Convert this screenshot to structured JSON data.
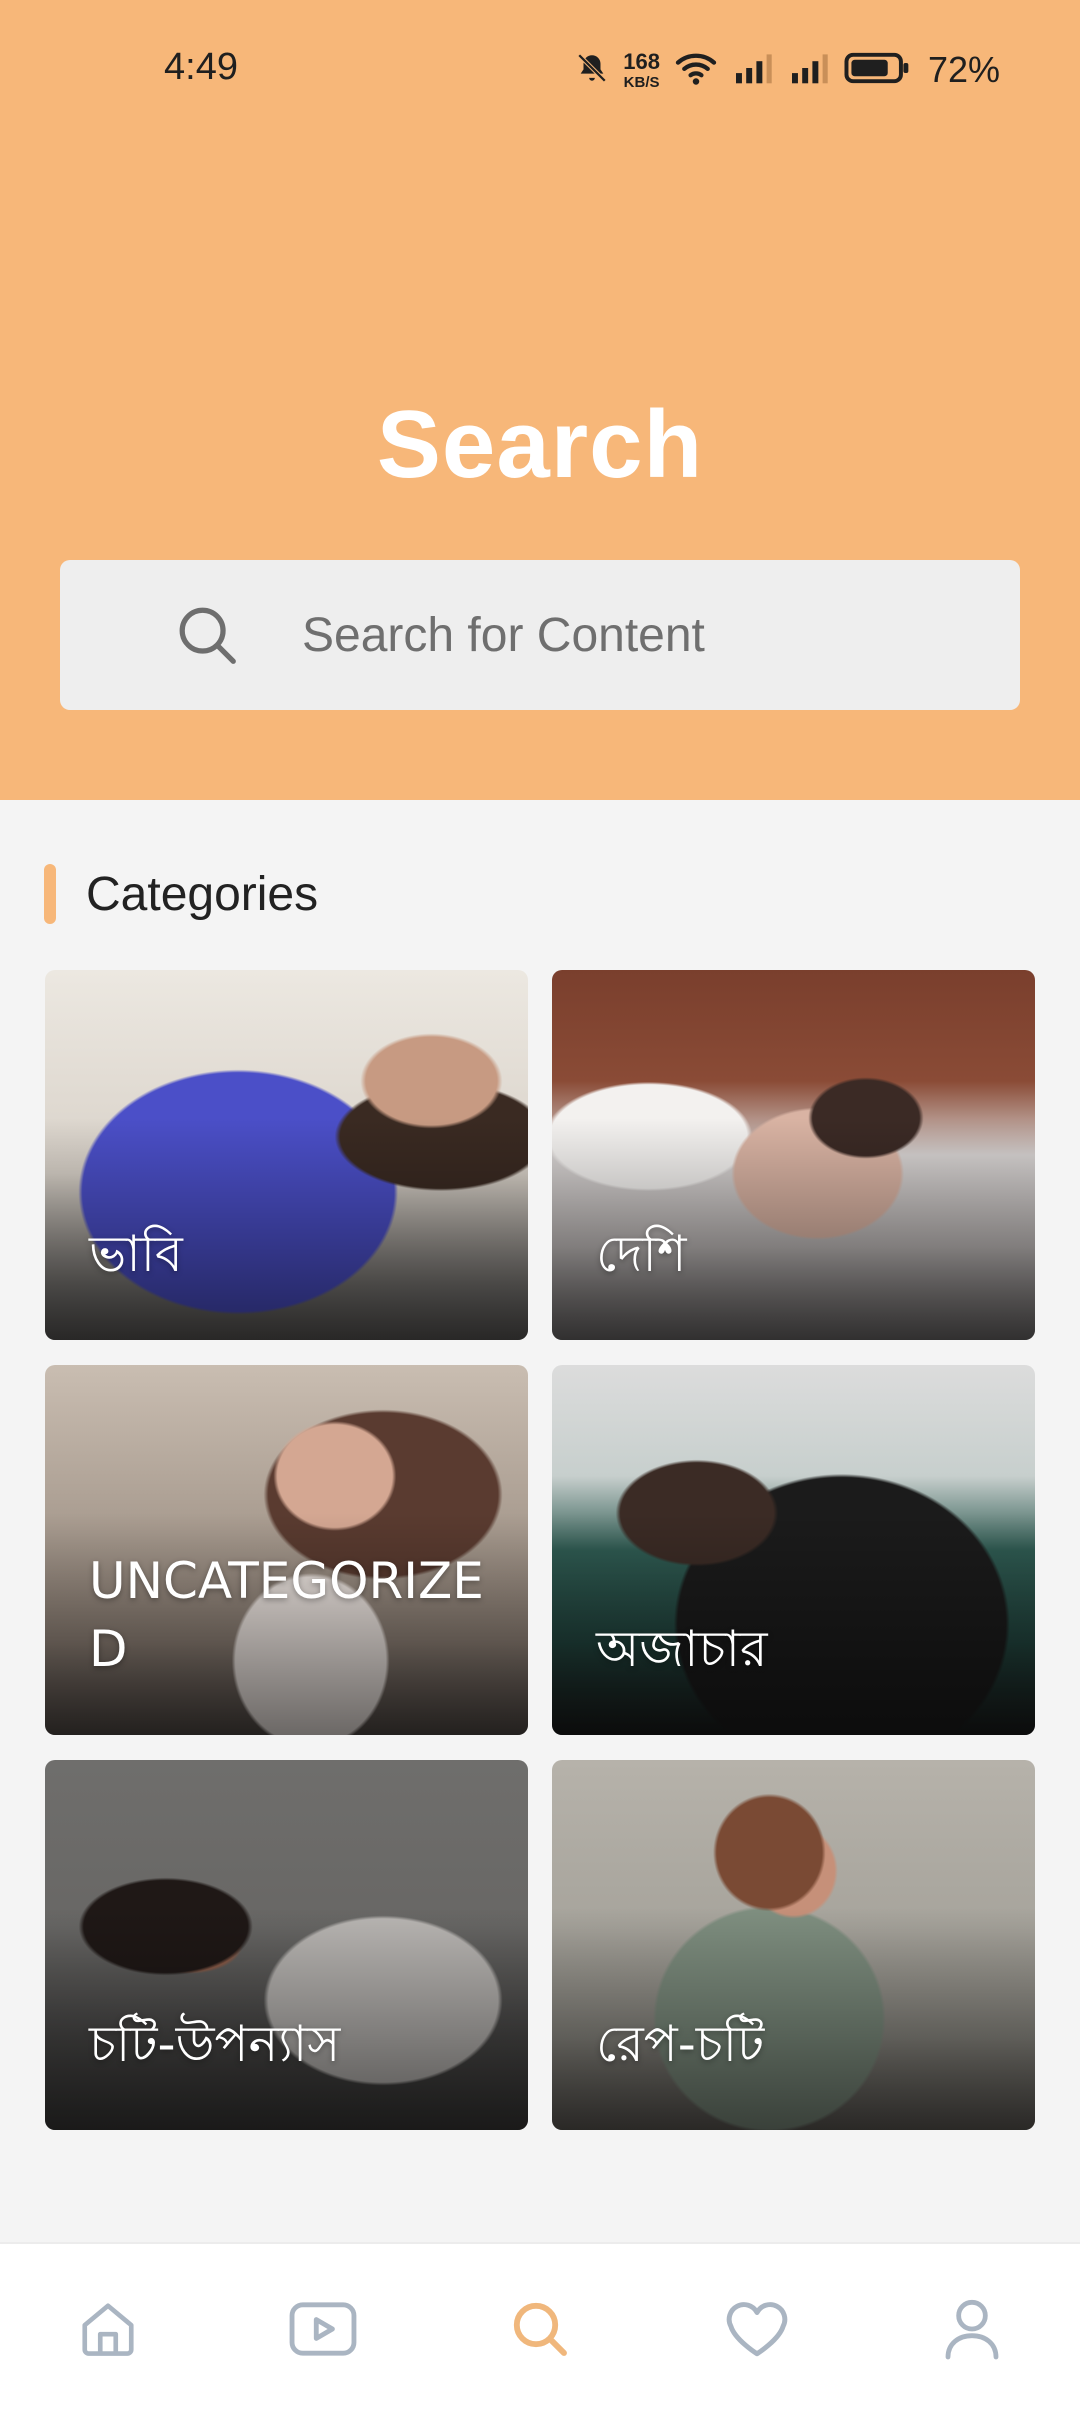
{
  "status_bar": {
    "time": "4:49",
    "net_speed_value": "168",
    "net_speed_unit": "KB/S",
    "battery_percent": "72%"
  },
  "header": {
    "title": "Search",
    "background_color": "#f7b779"
  },
  "search": {
    "placeholder": "Search for Content",
    "icon": "search-icon"
  },
  "categories": {
    "heading": "Categories",
    "accent_color": "#f7b779",
    "items": [
      {
        "label": "ভাবি"
      },
      {
        "label": "দেশি"
      },
      {
        "label": "UNCATEGORIZED"
      },
      {
        "label": "অজাচার"
      },
      {
        "label": "চটি-উপন্যাস"
      },
      {
        "label": "রেপ-চটি"
      }
    ]
  },
  "bottom_nav": {
    "items": [
      {
        "icon": "home-icon",
        "active": false
      },
      {
        "icon": "video-play-icon",
        "active": false
      },
      {
        "icon": "search-icon",
        "active": true
      },
      {
        "icon": "heart-icon",
        "active": false
      },
      {
        "icon": "profile-icon",
        "active": false
      }
    ],
    "active_color": "#f0b77c",
    "inactive_color": "#aab5c2"
  }
}
